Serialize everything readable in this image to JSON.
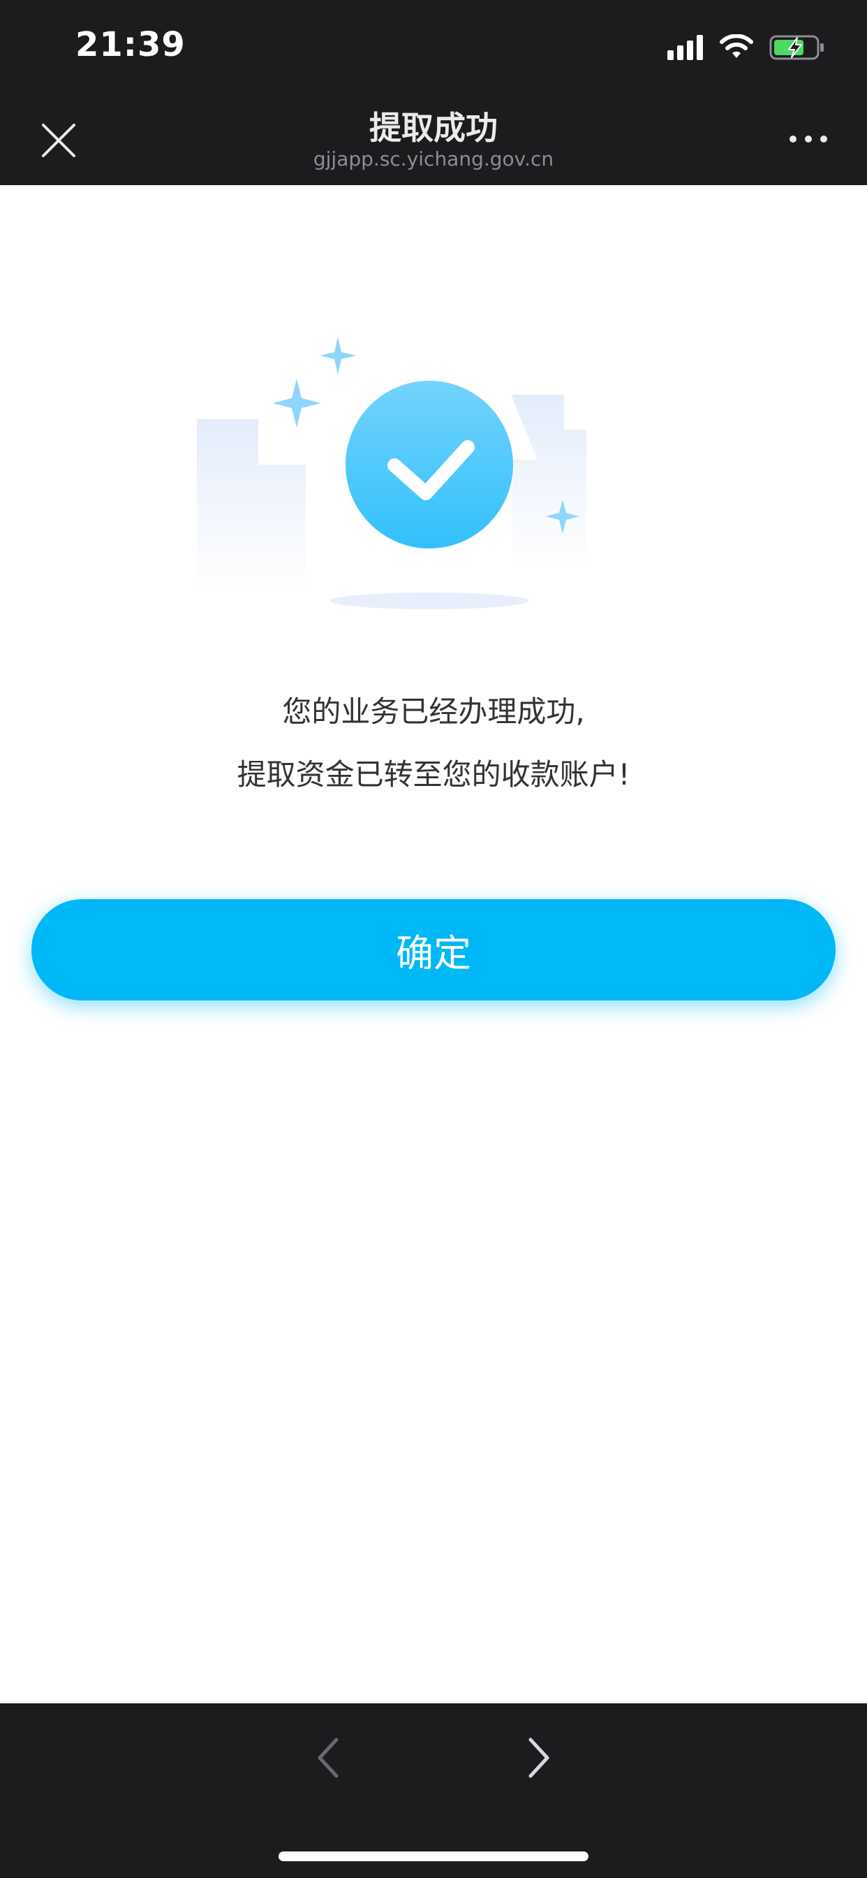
{
  "status_bar": {
    "time": "21:39",
    "icons": [
      "cellular-signal-icon",
      "wifi-icon",
      "battery-charging-icon"
    ]
  },
  "nav": {
    "title": "提取成功",
    "subtitle": "gjjapp.sc.yichang.gov.cn",
    "icons": [
      "close-icon",
      "more-icon"
    ]
  },
  "illustration": {
    "icon": "success-check-icon",
    "accent_color": "#3ec4fb"
  },
  "message": {
    "line1": "您的业务已经办理成功,",
    "line2": "提取资金已转至您的收款账户!"
  },
  "confirm": {
    "label": "确定",
    "color": "#00b8f6"
  },
  "toolbar": {
    "icons": [
      "chevron-left-icon",
      "chevron-right-icon"
    ]
  }
}
